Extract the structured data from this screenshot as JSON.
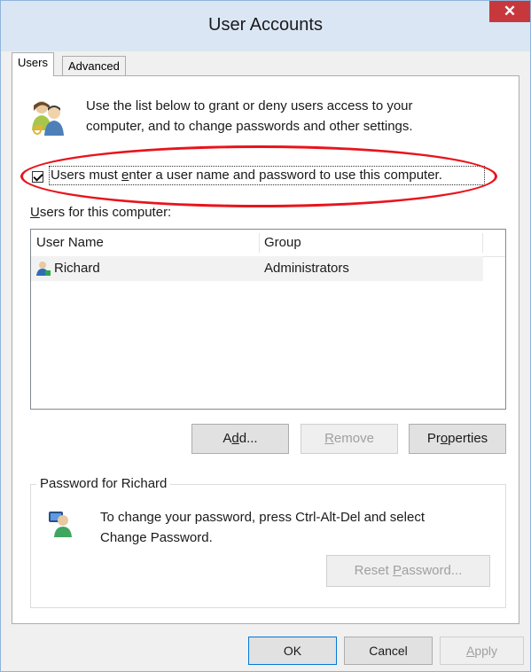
{
  "window": {
    "title": "User Accounts",
    "close_label": "✕"
  },
  "tabs": [
    {
      "label": "Users",
      "active": true
    },
    {
      "label": "Advanced",
      "active": false
    }
  ],
  "intro": {
    "line1": "Use the list below to grant or deny users access to your",
    "line2": "computer, and to change passwords and other settings.",
    "icon": "users-group-icon"
  },
  "require_password": {
    "checked": true,
    "label_pre": "Users must ",
    "label_accel": "e",
    "label_post": "nter a user name and password to use this computer."
  },
  "users_list": {
    "label_accel": "U",
    "label_rest": "sers for this computer:",
    "columns": [
      "User Name",
      "Group"
    ],
    "rows": [
      {
        "name": "Richard",
        "group": "Administrators",
        "icon": "user-icon"
      }
    ]
  },
  "list_buttons": {
    "add_pre": "A",
    "add_accel": "d",
    "add_post": "d...",
    "remove_accel": "R",
    "remove_rest": "emove",
    "properties_pre": "Pr",
    "properties_accel": "o",
    "properties_post": "perties"
  },
  "password_group": {
    "title": "Password for Richard",
    "line1": "To change your password, press Ctrl-Alt-Del and select",
    "line2": "Change Password.",
    "reset_pre": "Reset ",
    "reset_accel": "P",
    "reset_post": "assword...",
    "icon": "user-password-icon"
  },
  "dialog_buttons": {
    "ok": "OK",
    "cancel": "Cancel",
    "apply_accel": "A",
    "apply_rest": "pply"
  },
  "colors": {
    "title_bg": "#dbe6f4",
    "close_bg": "#c7383c",
    "annotation": "#e8141b",
    "row_bg": "#f2f2f2"
  }
}
